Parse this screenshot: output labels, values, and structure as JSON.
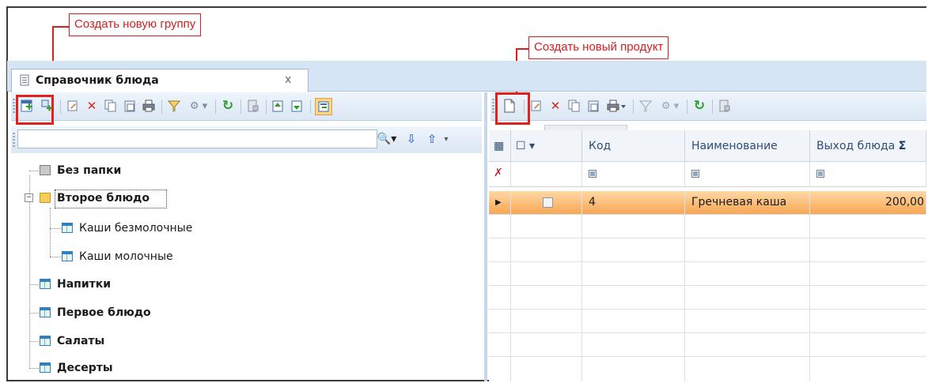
{
  "annotations": {
    "new_group": "Создать новую группу",
    "new_product": "Создать новый продукт"
  },
  "document_tab": {
    "title": "Справочник блюда",
    "close": "x"
  },
  "left_toolbar": {
    "icons": [
      "add-group-icon",
      "add-subgroup-icon",
      "edit-icon",
      "delete-icon",
      "copy-icon",
      "paste-icon",
      "print-icon",
      "filter-icon",
      "tools-dropdown-icon",
      "refresh-icon",
      "export-icon",
      "move-up-icon",
      "move-down-icon",
      "tree-view-toggle-icon"
    ]
  },
  "search": {
    "placeholder": ""
  },
  "tree": {
    "items": [
      {
        "label": "Без папки",
        "bold": true,
        "icon": "folder-gray-icon"
      },
      {
        "label": "Второе блюдо",
        "bold": true,
        "icon": "folder-open-icon",
        "expanded": true
      },
      {
        "label": "Каши безмолочные",
        "bold": false,
        "icon": "table-icon"
      },
      {
        "label": "Каши молочные",
        "bold": false,
        "icon": "table-icon"
      },
      {
        "label": "Напитки",
        "bold": true,
        "icon": "table-icon"
      },
      {
        "label": "Первое блюдо",
        "bold": true,
        "icon": "table-icon"
      },
      {
        "label": "Салаты",
        "bold": true,
        "icon": "table-icon"
      },
      {
        "label": "Десерты",
        "bold": true,
        "icon": "table-icon"
      }
    ]
  },
  "right_toolbar": {
    "icons": [
      "new-document-icon",
      "edit-icon",
      "delete-icon",
      "copy-icon",
      "paste-icon",
      "print-icon",
      "filter-icon",
      "tools-dropdown-icon",
      "refresh-icon",
      "export-icon"
    ]
  },
  "grid": {
    "columns": [
      "",
      "",
      "Код",
      "Наименование",
      "Выход блюда"
    ],
    "rows": [
      {
        "code": "4",
        "name": "Гречневая каша",
        "output": "200,00"
      }
    ],
    "sum_symbol": "Σ"
  },
  "colors": {
    "annotation_red": "#d42020",
    "selection_orange": "#f7a653",
    "band_blue": "#d6e5f5"
  }
}
